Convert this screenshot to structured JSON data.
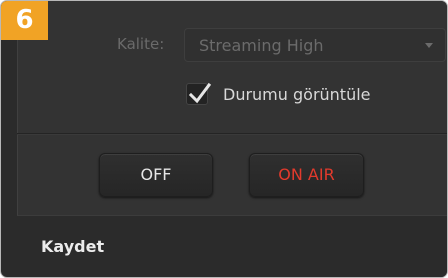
{
  "step_badge": {
    "number": "6"
  },
  "quality": {
    "label": "Kalite:",
    "selected_value": "Streaming High",
    "dropdown_icon": "chevron-down-icon"
  },
  "display_status": {
    "label": "Durumu görüntüle",
    "checked": true,
    "icon": "checkmark-icon"
  },
  "buttons": {
    "off_label": "OFF",
    "on_air_label": "ON AIR"
  },
  "footer": {
    "title": "Kaydet"
  },
  "colors": {
    "badge": "#f1a325",
    "on_air_text": "#e23a2c",
    "panel_bg": "#333333",
    "window_bg": "#2b2b2b"
  }
}
